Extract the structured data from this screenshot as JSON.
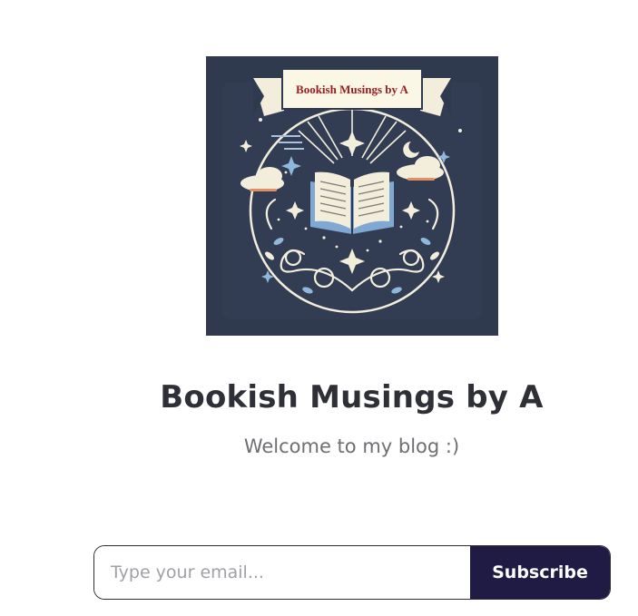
{
  "blog": {
    "logo_banner_text": "Bookish Musings by A",
    "title": "Bookish Musings by A",
    "tagline": "Welcome to my blog :)"
  },
  "subscribe": {
    "placeholder": "Type your email...",
    "button_label": "Subscribe"
  },
  "colors": {
    "logo_background": "#303a4f",
    "banner_text": "#9b1c1c",
    "button_background": "#1f1b45"
  }
}
